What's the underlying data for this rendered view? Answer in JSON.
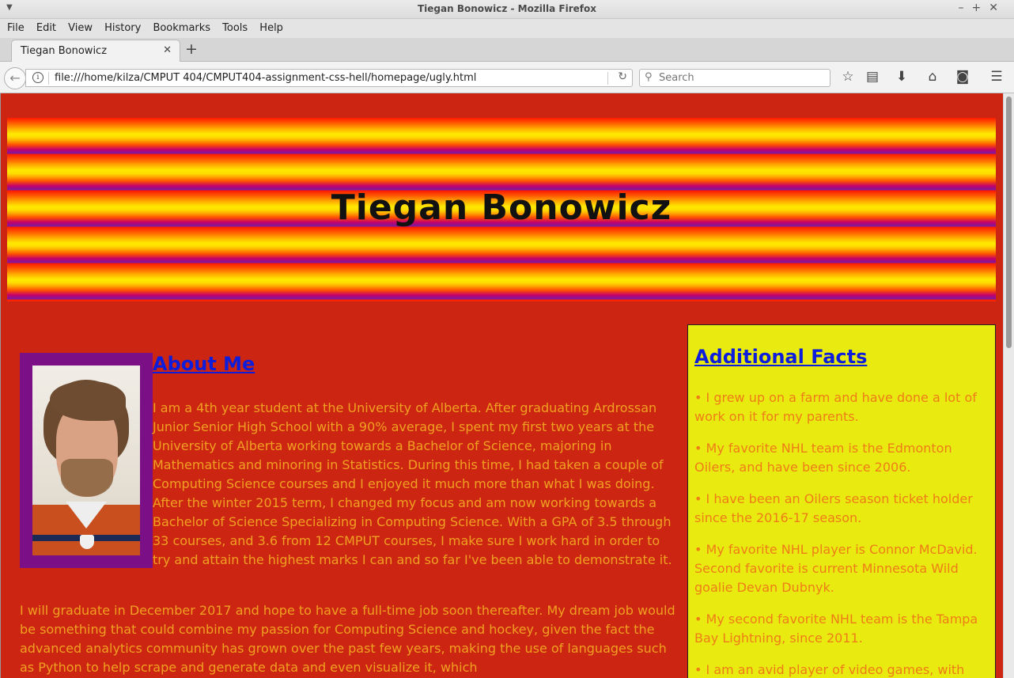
{
  "window": {
    "title": "Tiegan Bonowicz - Mozilla Firefox"
  },
  "menubar": {
    "items": [
      "File",
      "Edit",
      "View",
      "History",
      "Bookmarks",
      "Tools",
      "Help"
    ]
  },
  "tabs": [
    {
      "label": "Tiegan Bonowicz",
      "active": true
    }
  ],
  "navbar": {
    "url": "file:///home/kilza/CMPUT 404/CMPUT404-assignment-css-hell/homepage/ugly.html",
    "search_placeholder": "Search"
  },
  "page": {
    "heading": "Tiegan Bonowicz",
    "about": {
      "title": "About Me",
      "paragraph1": "I am a 4th year student at the University of Alberta. After graduating Ardrossan Junior Senior High School with a 90% average, I spent my first two years at the University of Alberta working towards a Bachelor of Science, majoring in Mathematics and minoring in Statistics. During this time, I had taken a couple of Computing Science courses and I enjoyed it much more than what I was doing. After the winter 2015 term, I changed my focus and am now working towards a Bachelor of Science Specializing in Computing Science. With a GPA of 3.5 through 33 courses, and 3.6 from 12 CMPUT courses, I make sure I work hard in order to try and attain the highest marks I can and so far I've been able to demonstrate it.",
      "paragraph2": "I will graduate in December 2017 and hope to have a full-time job soon thereafter. My dream job would be something that could combine my passion for Computing Science and hockey, given the fact the advanced analytics community has grown over the past few years, making the use of languages such as Python to help scrape and generate data and even visualize it, which"
    },
    "facts": {
      "title": "Additional Facts",
      "items": [
        "• I grew up on a farm and have done a lot of work on it for my parents.",
        "• My favorite NHL team is the Edmonton Oilers, and have been since 2006.",
        "• I have been an Oilers season ticket holder since the 2016-17 season.",
        "• My favorite NHL player is Connor McDavid. Second favorite is current Minnesota Wild goalie Devan Dubnyk.",
        "• My second favorite NHL team is the Tampa Bay Lightning, since 2011.",
        "• I am an avid player of video games, with"
      ]
    }
  },
  "colors": {
    "page_background": "#cc2613",
    "body_text": "#f0a020",
    "link_heading": "#0d1ddc",
    "aside_background": "#e8ea10",
    "aside_text": "#ef7d17",
    "photo_frame": "#7b0f86"
  }
}
